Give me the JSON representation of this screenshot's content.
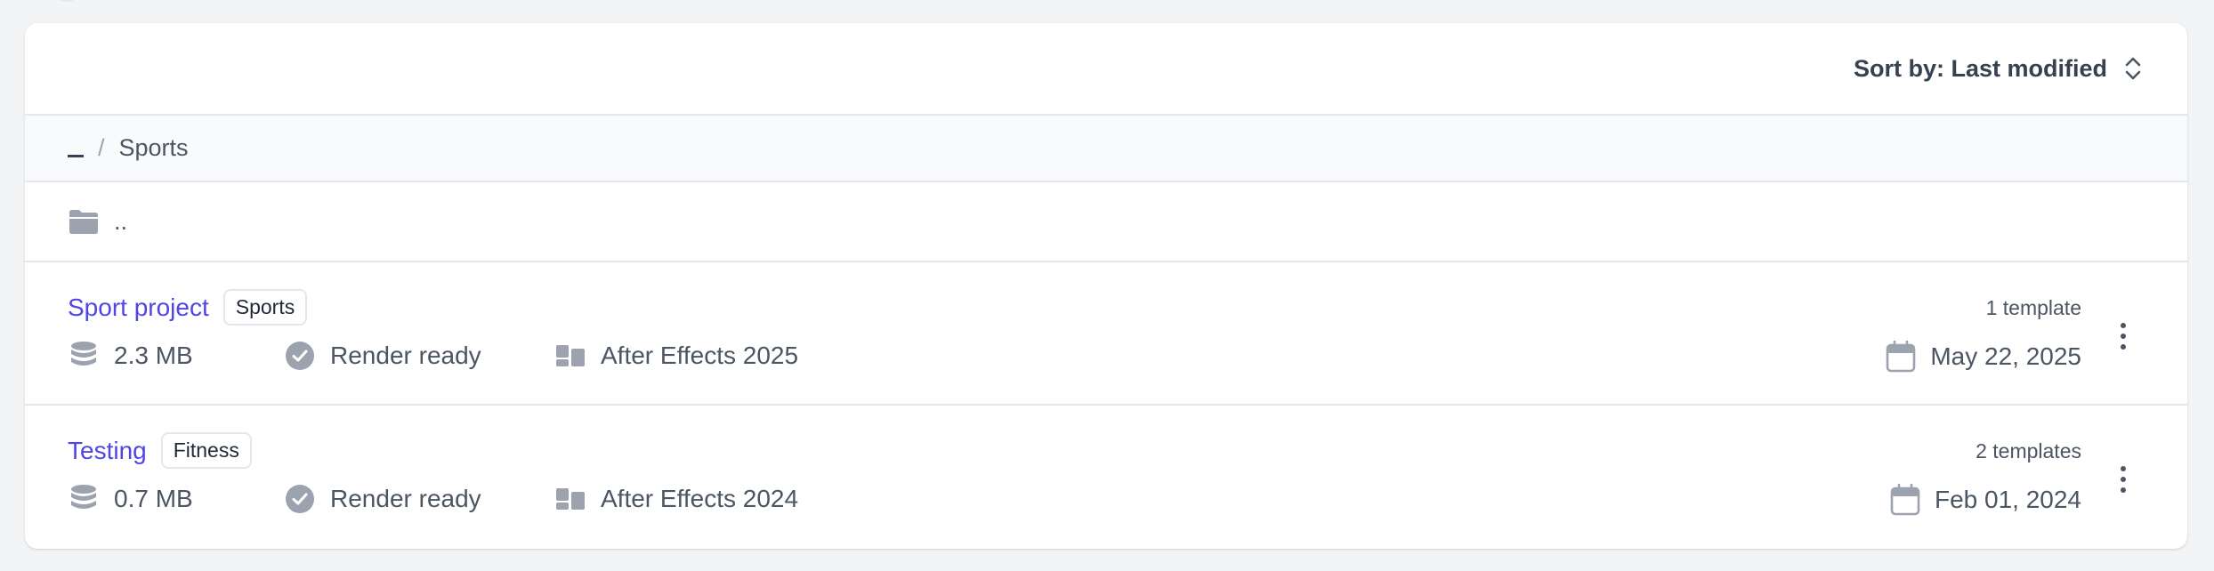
{
  "toolbar": {
    "sort_label": "Sort by: Last modified"
  },
  "breadcrumb": {
    "current": "Sports",
    "separator": "/"
  },
  "parent_row": {
    "label": ".."
  },
  "projects": [
    {
      "name": "Sport project",
      "tag": "Sports",
      "size": "2.3 MB",
      "status": "Render ready",
      "app": "After Effects 2025",
      "templates": "1 template",
      "date": "May 22, 2025"
    },
    {
      "name": "Testing",
      "tag": "Fitness",
      "size": "0.7 MB",
      "status": "Render ready",
      "app": "After Effects 2024",
      "templates": "2 templates",
      "date": "Feb 01, 2024"
    }
  ],
  "icons": {
    "sort": "chevron-up-down-icon",
    "folder": "folder-icon",
    "size": "database-icon",
    "status": "check-circle-icon",
    "app": "layout-icon",
    "date": "calendar-icon",
    "menu": "kebab-menu-icon"
  },
  "colors": {
    "link": "#4f46e5",
    "icon": "#9ca3af",
    "border": "#e5e7eb"
  }
}
